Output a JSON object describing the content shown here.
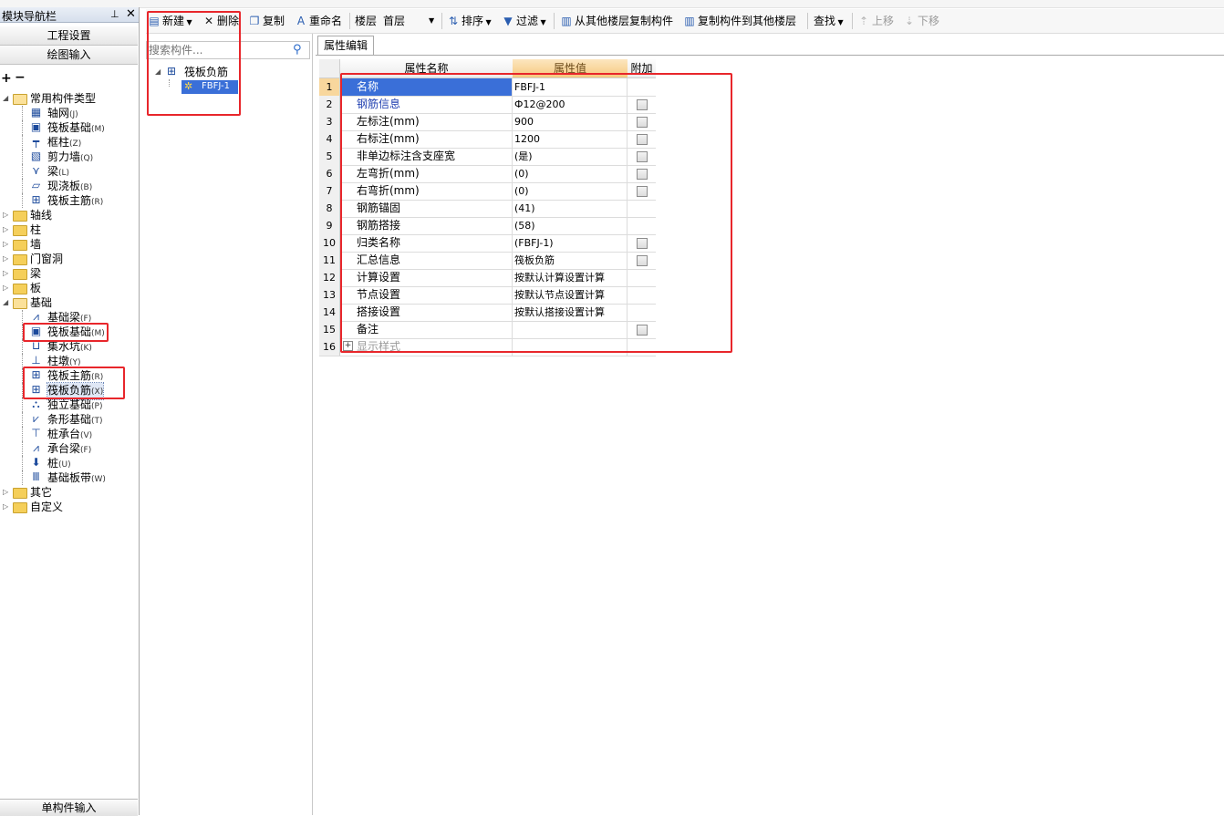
{
  "nav": {
    "title": "模块导航栏",
    "pin": "ᴾ",
    "close": "✕",
    "buttons": [
      "工程设置",
      "绘图输入"
    ],
    "toolbar_glyphs": "+ −",
    "tree": [
      {
        "label": "常用构件类型",
        "level": 0,
        "type": "folder",
        "expanded": true
      },
      {
        "label": "轴网",
        "key": "(J)",
        "level": 1,
        "icon": "grid-axis-icon"
      },
      {
        "label": "筏板基础",
        "key": "(M)",
        "level": 1,
        "icon": "raft-foundation-icon"
      },
      {
        "label": "框柱",
        "key": "(Z)",
        "level": 1,
        "icon": "frame-column-icon"
      },
      {
        "label": "剪力墙",
        "key": "(Q)",
        "level": 1,
        "icon": "shear-wall-icon"
      },
      {
        "label": "梁",
        "key": "(L)",
        "level": 1,
        "icon": "beam-icon"
      },
      {
        "label": "现浇板",
        "key": "(B)",
        "level": 1,
        "icon": "slab-icon"
      },
      {
        "label": "筏板主筋",
        "key": "(R)",
        "level": 1,
        "icon": "raft-main-rebar-icon"
      },
      {
        "label": "轴线",
        "level": 0,
        "type": "folder",
        "expanded": false
      },
      {
        "label": "柱",
        "level": 0,
        "type": "folder",
        "expanded": false
      },
      {
        "label": "墙",
        "level": 0,
        "type": "folder",
        "expanded": false
      },
      {
        "label": "门窗洞",
        "level": 0,
        "type": "folder",
        "expanded": false
      },
      {
        "label": "梁",
        "level": 0,
        "type": "folder",
        "expanded": false
      },
      {
        "label": "板",
        "level": 0,
        "type": "folder",
        "expanded": false
      },
      {
        "label": "基础",
        "level": 0,
        "type": "folder",
        "expanded": true
      },
      {
        "label": "基础梁",
        "key": "(F)",
        "level": 1,
        "icon": "foundation-beam-icon"
      },
      {
        "label": "筏板基础",
        "key": "(M)",
        "level": 1,
        "icon": "raft-foundation-icon"
      },
      {
        "label": "集水坑",
        "key": "(K)",
        "level": 1,
        "icon": "sump-pit-icon"
      },
      {
        "label": "柱墩",
        "key": "(Y)",
        "level": 1,
        "icon": "column-pier-icon"
      },
      {
        "label": "筏板主筋",
        "key": "(R)",
        "level": 1,
        "icon": "raft-main-rebar-icon"
      },
      {
        "label": "筏板负筋",
        "key": "(X)",
        "level": 1,
        "icon": "raft-negative-rebar-icon",
        "selected": true
      },
      {
        "label": "独立基础",
        "key": "(P)",
        "level": 1,
        "icon": "isolated-footing-icon"
      },
      {
        "label": "条形基础",
        "key": "(T)",
        "level": 1,
        "icon": "strip-footing-icon"
      },
      {
        "label": "桩承台",
        "key": "(V)",
        "level": 1,
        "icon": "pile-cap-icon"
      },
      {
        "label": "承台梁",
        "key": "(F)",
        "level": 1,
        "icon": "cap-beam-icon"
      },
      {
        "label": "桩",
        "key": "(U)",
        "level": 1,
        "icon": "pile-icon"
      },
      {
        "label": "基础板带",
        "key": "(W)",
        "level": 1,
        "icon": "foundation-strip-icon"
      },
      {
        "label": "其它",
        "level": 0,
        "type": "folder",
        "expanded": false
      },
      {
        "label": "自定义",
        "level": 0,
        "type": "folder",
        "expanded": false
      }
    ],
    "bottom_button": "单构件输入"
  },
  "toolbar": {
    "new": "新建",
    "delete": "删除",
    "copy": "复制",
    "rename": "重命名",
    "floor_label": "楼层",
    "floor_value": "首层",
    "sort": "排序",
    "filter": "过滤",
    "copy_from_other": "从其他楼层复制构件",
    "copy_to_other": "复制构件到其他楼层",
    "find": "查找",
    "move_up": "上移",
    "move_down": "下移"
  },
  "components": {
    "search_placeholder": "搜索构件...",
    "root_label": "筏板负筋",
    "child_label": "FBFJ-1"
  },
  "properties": {
    "tab": "属性编辑",
    "headers": {
      "name": "属性名称",
      "value": "属性值",
      "extra": "附加"
    },
    "rows": [
      {
        "num": "1",
        "name": "名称",
        "value": "FBFJ-1",
        "check": false,
        "blue": false,
        "selected": true
      },
      {
        "num": "2",
        "name": "钢筋信息",
        "value": "Ф12@200",
        "check": true,
        "blue": true
      },
      {
        "num": "3",
        "name": "左标注(mm)",
        "value": "900",
        "check": true
      },
      {
        "num": "4",
        "name": "右标注(mm)",
        "value": "1200",
        "check": true
      },
      {
        "num": "5",
        "name": "非单边标注含支座宽",
        "value": "(是)",
        "check": true
      },
      {
        "num": "6",
        "name": "左弯折(mm)",
        "value": "(0)",
        "check": true
      },
      {
        "num": "7",
        "name": "右弯折(mm)",
        "value": "(0)",
        "check": true
      },
      {
        "num": "8",
        "name": "钢筋锚固",
        "value": "(41)",
        "check": false
      },
      {
        "num": "9",
        "name": "钢筋搭接",
        "value": "(58)",
        "check": false
      },
      {
        "num": "10",
        "name": "归类名称",
        "value": "(FBFJ-1)",
        "check": true
      },
      {
        "num": "11",
        "name": "汇总信息",
        "value": "筏板负筋",
        "check": true
      },
      {
        "num": "12",
        "name": "计算设置",
        "value": "按默认计算设置计算",
        "check": false
      },
      {
        "num": "13",
        "name": "节点设置",
        "value": "按默认节点设置计算",
        "check": false
      },
      {
        "num": "14",
        "name": "搭接设置",
        "value": "按默认搭接设置计算",
        "check": false
      },
      {
        "num": "15",
        "name": "备注",
        "value": "",
        "check": true
      },
      {
        "num": "16",
        "name": "显示样式",
        "value": "",
        "check": false,
        "expandable": true,
        "muted": true
      }
    ]
  },
  "colors": {
    "highlight_red": "#e8262b",
    "value_header": "#f6c97e",
    "selection": "#3a6fd8"
  }
}
